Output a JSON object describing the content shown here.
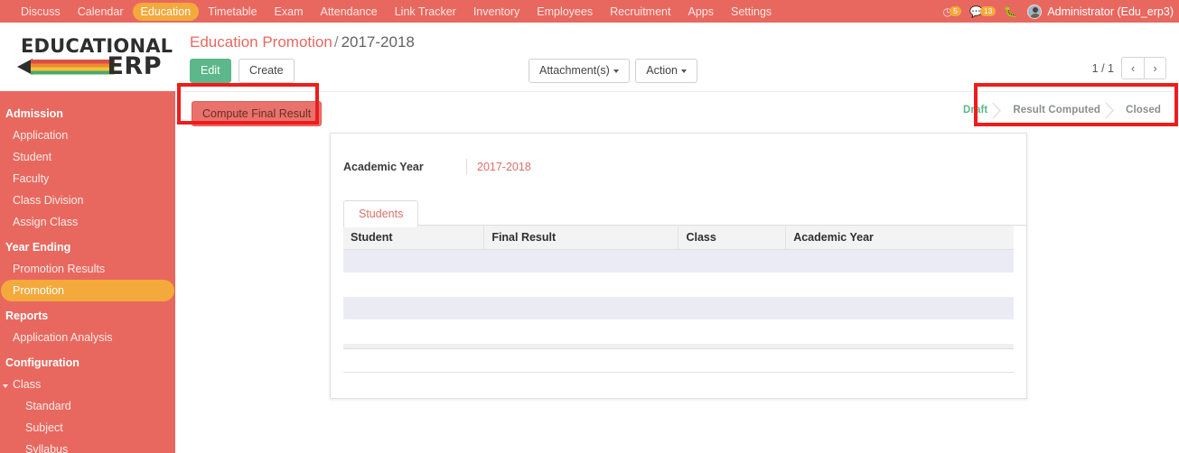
{
  "topnav": {
    "items": [
      {
        "label": "Discuss",
        "active": false
      },
      {
        "label": "Calendar",
        "active": false
      },
      {
        "label": "Education",
        "active": true
      },
      {
        "label": "Timetable",
        "active": false
      },
      {
        "label": "Exam",
        "active": false
      },
      {
        "label": "Attendance",
        "active": false
      },
      {
        "label": "Link Tracker",
        "active": false
      },
      {
        "label": "Inventory",
        "active": false
      },
      {
        "label": "Employees",
        "active": false
      },
      {
        "label": "Recruitment",
        "active": false
      },
      {
        "label": "Apps",
        "active": false
      },
      {
        "label": "Settings",
        "active": false
      }
    ],
    "activity_icon": "clock-icon",
    "activity_count": "5",
    "messages_icon": "comment-icon",
    "messages_count": "13",
    "debug_icon": "bug-icon",
    "avatar_icon": "user-avatar-icon",
    "user": "Administrator (Edu_erp3)"
  },
  "sidebar": {
    "logo": {
      "line1": "EDUCATIONAL",
      "line2": "ERP",
      "graphic": "pencil-icon"
    },
    "groups": [
      {
        "header": "Admission",
        "items": [
          {
            "label": "Application",
            "active": false,
            "level": 1
          },
          {
            "label": "Student",
            "active": false,
            "level": 1
          },
          {
            "label": "Faculty",
            "active": false,
            "level": 1
          },
          {
            "label": "Class Division",
            "active": false,
            "level": 1
          },
          {
            "label": "Assign Class",
            "active": false,
            "level": 1
          }
        ]
      },
      {
        "header": "Year Ending",
        "items": [
          {
            "label": "Promotion Results",
            "active": false,
            "level": 1
          },
          {
            "label": "Promotion",
            "active": true,
            "level": 1
          }
        ]
      },
      {
        "header": "Reports",
        "items": [
          {
            "label": "Application Analysis",
            "active": false,
            "level": 1
          }
        ]
      },
      {
        "header": "Configuration",
        "items": [
          {
            "label": "Class",
            "active": false,
            "level": 1,
            "caret": true
          },
          {
            "label": "Standard",
            "active": false,
            "level": 2
          },
          {
            "label": "Subject",
            "active": false,
            "level": 2
          },
          {
            "label": "Syllabus",
            "active": false,
            "level": 2
          }
        ]
      }
    ]
  },
  "breadcrumb": {
    "parent": "Education Promotion",
    "separator": "/",
    "current": "2017-2018"
  },
  "toolbar": {
    "edit_label": "Edit",
    "create_label": "Create",
    "attachments_label": "Attachment(s)",
    "action_label": "Action",
    "pager_count": "1 / 1",
    "prev_icon": "chevron-left-icon",
    "next_icon": "chevron-right-icon"
  },
  "action_bar": {
    "compute_label": "Compute Final Result"
  },
  "statusbar": {
    "stages": [
      {
        "label": "Draft",
        "active": true
      },
      {
        "label": "Result Computed",
        "active": false
      },
      {
        "label": "Closed",
        "active": false
      }
    ]
  },
  "form": {
    "academic_year_label": "Academic Year",
    "academic_year_value": "2017-2018",
    "tabs": [
      {
        "label": "Students",
        "active": true
      }
    ],
    "grid": {
      "columns": [
        "Student",
        "Final Result",
        "Class",
        "Academic Year"
      ],
      "rows": []
    }
  },
  "annotations": [
    {
      "name": "compute-final-result-highlight",
      "color": "#ee1c1c"
    },
    {
      "name": "statusbar-highlight",
      "color": "#ee1c1c"
    }
  ]
}
